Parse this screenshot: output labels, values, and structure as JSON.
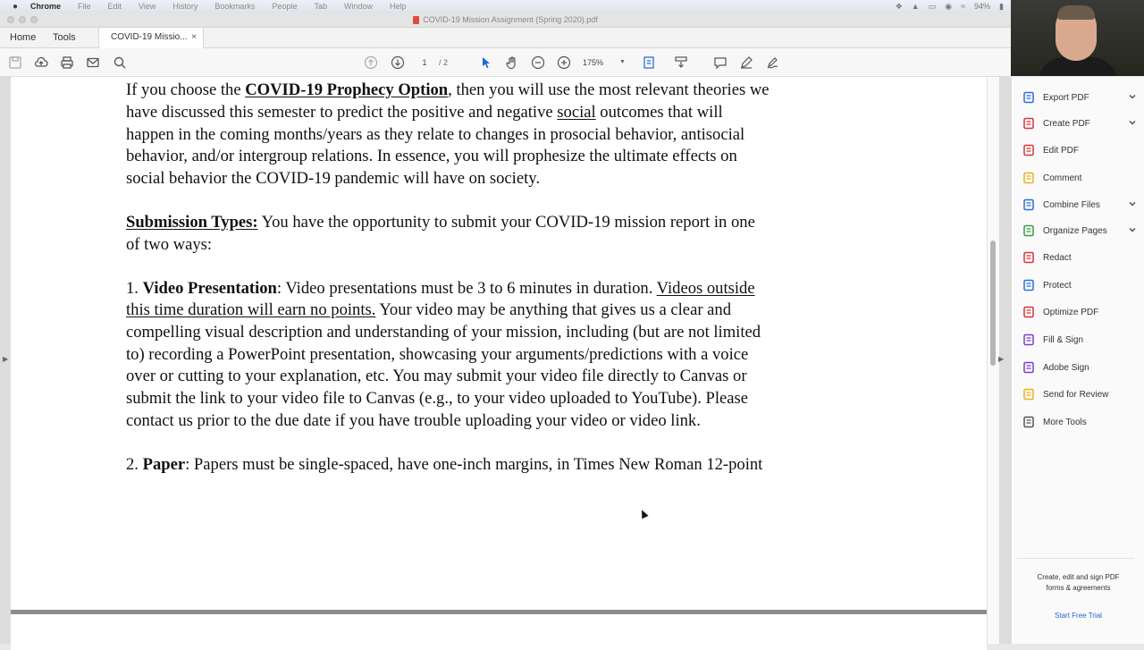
{
  "menubar": {
    "apple_glyph": "",
    "items": [
      "Chrome",
      "File",
      "Edit",
      "View",
      "History",
      "Bookmarks",
      "People",
      "Tab",
      "Window",
      "Help"
    ],
    "battery": "94%"
  },
  "window": {
    "title": "COVID-19 Mission Assignment (Spring 2020).pdf"
  },
  "tabs": {
    "home": "Home",
    "tools": "Tools",
    "active": "COVID-19 Missio...",
    "close": "×"
  },
  "toolbar": {
    "page_current": "1",
    "page_total": "/ 2",
    "zoom": "175%",
    "icons": [
      "save-icon",
      "upload-icon",
      "print-icon",
      "mail-icon",
      "search-icon",
      "prev-page-icon",
      "next-page-icon",
      "select-cursor-icon",
      "hand-icon",
      "zoom-out-icon",
      "zoom-in-icon",
      "fit-page-icon",
      "scroll-mode-icon",
      "comment-icon",
      "pen-icon",
      "sign-icon"
    ]
  },
  "document": {
    "p1": {
      "lead": "If you choose the ",
      "option": "COVID-19 Prophecy Option",
      "rest1": ", then you will use the most relevant theories we",
      "l2a": "have discussed this semester to predict the positive and negative ",
      "social": "social",
      "l2b": " outcomes that will",
      "l3": "happen in the coming months/years as they relate to changes in prosocial behavior, antisocial",
      "l4": "behavior, and/or intergroup relations. In essence, you will prophesize the ultimate effects on",
      "l5": "social behavior the COVID-19 pandemic will have on society."
    },
    "p2": {
      "heading": "Submission Types:",
      "l1": " You have the opportunity to submit your COVID-19 mission report in one",
      "l2": "of two ways:"
    },
    "p3": {
      "num": "1. ",
      "heading": "Video Presentation",
      "l1": ": Video presentations must be 3 to 6 minutes in duration.  ",
      "u1": "Videos outside",
      "u2": "this time duration will earn no points.",
      "l2": " Your video may be anything that gives us a clear and",
      "l3": "compelling visual description and understanding of your mission, including (but are not limited",
      "l4": "to) recording a PowerPoint presentation, showcasing your arguments/predictions with a voice",
      "l5": "over or cutting to your explanation, etc.  You may submit your video file directly to Canvas or",
      "l6": "submit the link to your video file to Canvas (e.g., to your video uploaded to YouTube).  Please",
      "l7": "contact us prior to the due date if you have trouble uploading your video or video link."
    },
    "p4": {
      "num": "2. ",
      "heading": "Paper",
      "l1": ": Papers must be single-spaced, have one-inch margins, in Times New Roman 12-point"
    }
  },
  "tools_pane": {
    "items": [
      {
        "label": "Export PDF",
        "icon": "export-pdf-icon",
        "color": "#2b6fd6",
        "chevron": true
      },
      {
        "label": "Create PDF",
        "icon": "create-pdf-icon",
        "color": "#d6343b",
        "chevron": true
      },
      {
        "label": "Edit PDF",
        "icon": "edit-pdf-icon",
        "color": "#d6343b",
        "chevron": false
      },
      {
        "label": "Comment",
        "icon": "comment-icon",
        "color": "#e8b21a",
        "chevron": false
      },
      {
        "label": "Combine Files",
        "icon": "combine-files-icon",
        "color": "#2b6fd6",
        "chevron": true
      },
      {
        "label": "Organize Pages",
        "icon": "organize-pages-icon",
        "color": "#3a9a44",
        "chevron": true
      },
      {
        "label": "Redact",
        "icon": "redact-icon",
        "color": "#d6343b",
        "chevron": false
      },
      {
        "label": "Protect",
        "icon": "protect-icon",
        "color": "#2b6fd6",
        "chevron": false
      },
      {
        "label": "Optimize PDF",
        "icon": "optimize-pdf-icon",
        "color": "#d6343b",
        "chevron": false
      },
      {
        "label": "Fill & Sign",
        "icon": "fill-sign-icon",
        "color": "#7b3fc6",
        "chevron": false
      },
      {
        "label": "Adobe Sign",
        "icon": "adobe-sign-icon",
        "color": "#7b3fc6",
        "chevron": false
      },
      {
        "label": "Send for Review",
        "icon": "send-review-icon",
        "color": "#e8b21a",
        "chevron": false
      },
      {
        "label": "More Tools",
        "icon": "more-tools-icon",
        "color": "#555555",
        "chevron": false
      }
    ],
    "promo_line1": "Create, edit and sign PDF",
    "promo_line2": "forms & agreements",
    "trial": "Start Free Trial"
  }
}
